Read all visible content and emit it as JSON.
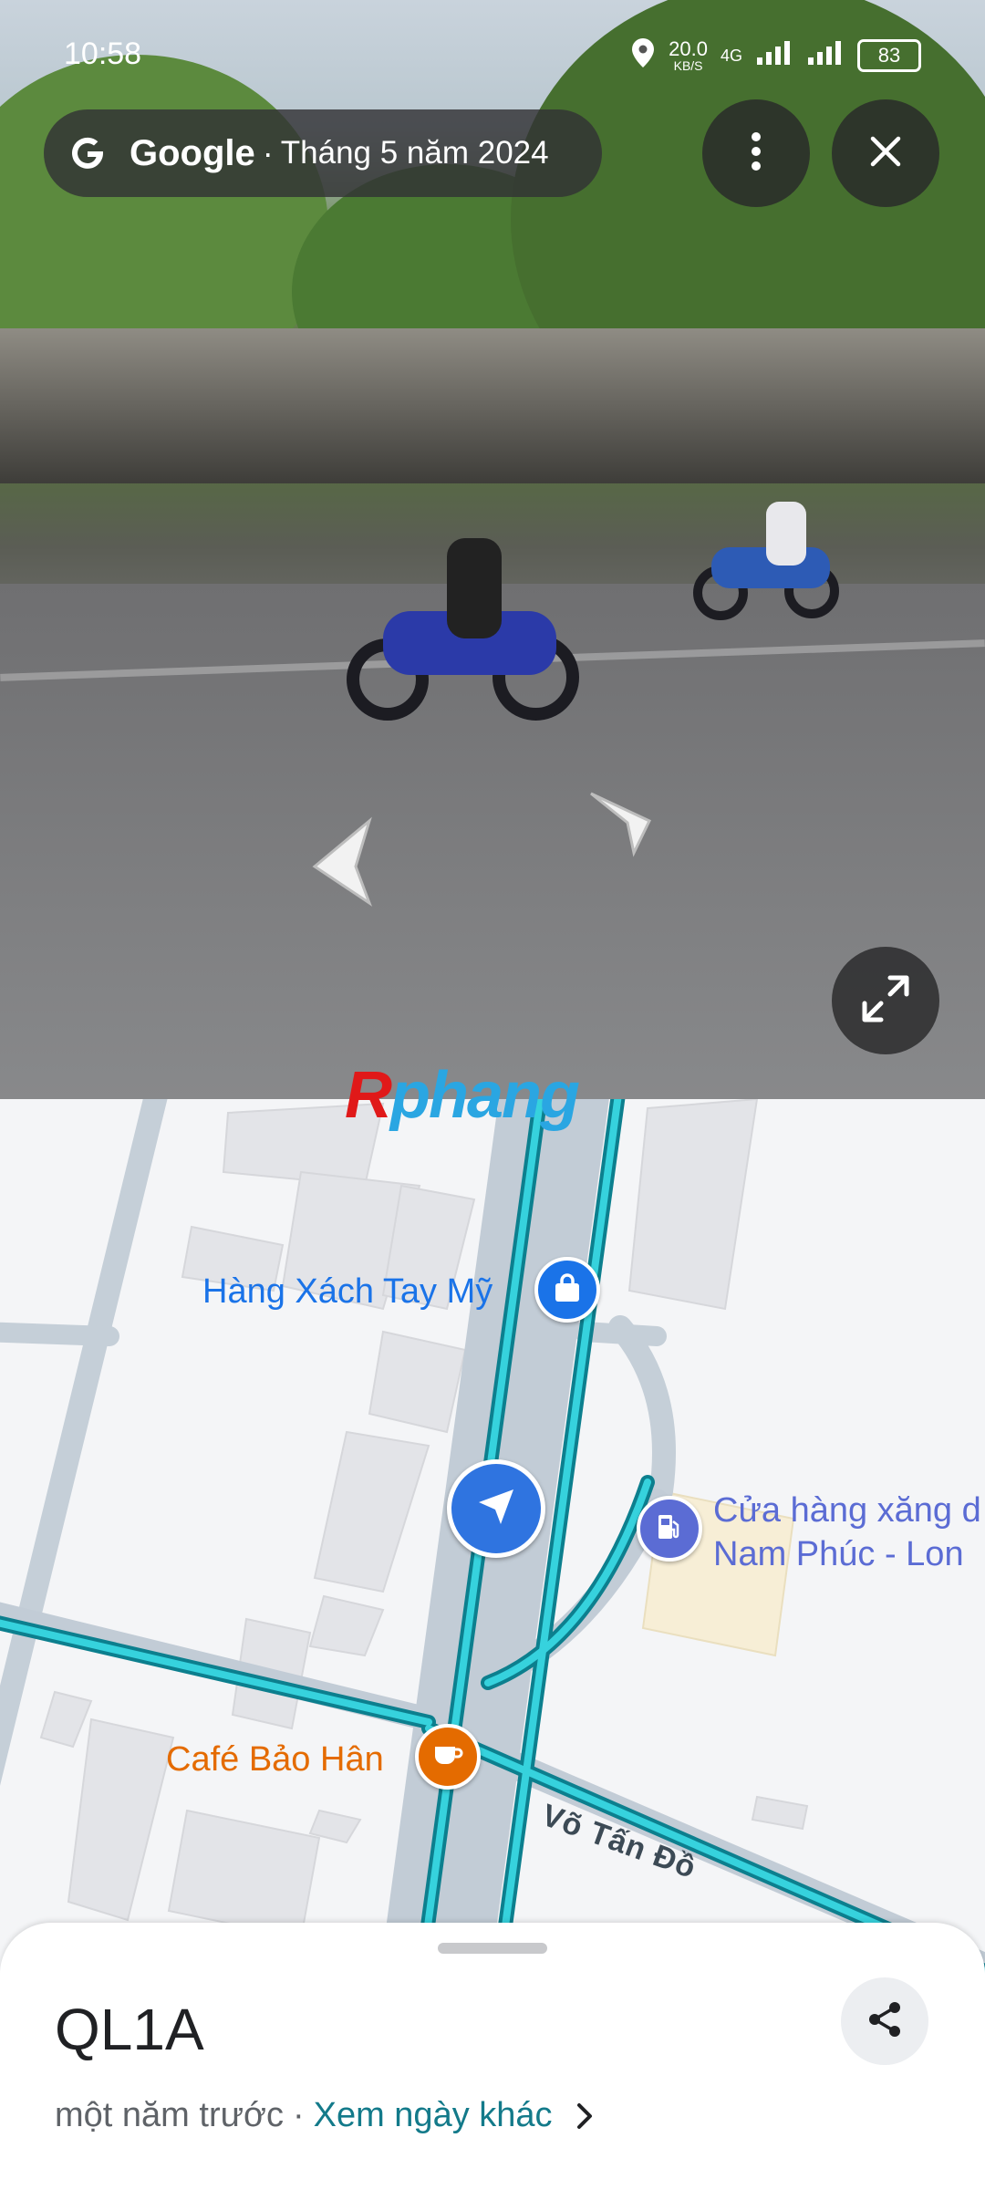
{
  "status_bar": {
    "time": "10:58",
    "net_speed": "20.0",
    "net_unit": "KB/S",
    "network": "4G",
    "battery": "83"
  },
  "streetview": {
    "brand": "Google",
    "separator": "·",
    "capture_date": "Tháng 5 năm 2024",
    "more_icon": "more-vert-icon",
    "close_icon": "close-icon",
    "expand_icon": "expand-icon"
  },
  "watermark": {
    "letter": "R",
    "rest": "phang"
  },
  "map": {
    "places": [
      {
        "name": "Hàng Xách Tay Mỹ",
        "icon": "shopping-bag-icon",
        "color": "#1a73e8"
      },
      {
        "name_line1": "Cửa hàng xăng d",
        "name_line2": "Nam Phúc - Lon",
        "icon": "gas-station-icon",
        "color": "#5b6cd4"
      },
      {
        "name": "Café Bảo Hân",
        "icon": "coffee-icon",
        "color": "#e46b00"
      }
    ],
    "road_label": "Võ Tấn Đồ",
    "route_color": "#1fb3c2"
  },
  "sheet": {
    "title": "QL1A",
    "relative_time": "một năm trước",
    "separator": "·",
    "other_dates_link": "Xem ngày khác",
    "share_icon": "share-icon"
  }
}
